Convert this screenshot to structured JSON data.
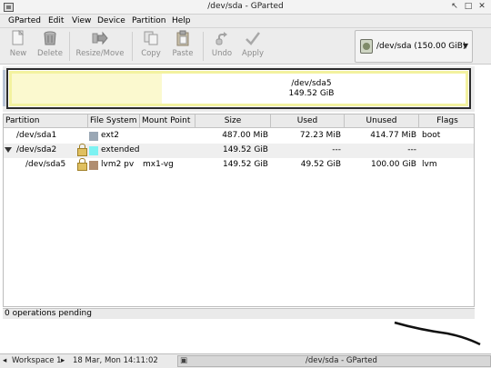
{
  "window": {
    "title": "/dev/sda - GParted",
    "controls": [
      "↖",
      "□",
      "✕"
    ]
  },
  "menu": [
    "GParted",
    "Edit",
    "View",
    "Device",
    "Partition",
    "Help"
  ],
  "toolbar": {
    "buttons": [
      {
        "label": "New",
        "icon": "new-icon"
      },
      {
        "label": "Delete",
        "icon": "delete-icon"
      },
      {
        "label": "Resize/Move",
        "icon": "resize-move-icon"
      },
      {
        "label": "Copy",
        "icon": "copy-icon"
      },
      {
        "label": "Paste",
        "icon": "paste-icon"
      },
      {
        "label": "Undo",
        "icon": "undo-icon"
      },
      {
        "label": "Apply",
        "icon": "apply-icon"
      }
    ],
    "device_selector": "/dev/sda  (150.00 GiB)"
  },
  "visual": {
    "name": "/dev/sda5",
    "size": "149.52 GiB",
    "used_fraction": 0.33
  },
  "table": {
    "columns": [
      "Partition",
      "File System",
      "Mount Point",
      "Size",
      "Used",
      "Unused",
      "Flags"
    ],
    "rows": [
      {
        "partition": "/dev/sda1",
        "filesystem": "ext2",
        "fs_color": "#9aa7b5",
        "mount": "",
        "size": "487.00 MiB",
        "used": "72.23 MiB",
        "unused": "414.77 MiB",
        "flags": "boot",
        "locked": false,
        "expander": false
      },
      {
        "partition": "/dev/sda2",
        "filesystem": "extended",
        "fs_color": "#7df2f2",
        "mount": "",
        "size": "149.52 GiB",
        "used": "---",
        "unused": "---",
        "flags": "",
        "locked": true,
        "expander": true
      },
      {
        "partition": "/dev/sda5",
        "filesystem": "lvm2 pv",
        "fs_color": "#b08d70",
        "mount": "mx1-vg",
        "size": "149.52 GiB",
        "used": "49.52 GiB",
        "unused": "100.00 GiB",
        "flags": "lvm",
        "locked": true,
        "expander": false
      }
    ]
  },
  "status": "0 operations pending",
  "taskbar": {
    "workspace": "Workspace 1",
    "clock": "18 Mar, Mon 14:11:02",
    "app_title": "/dev/sda - GParted"
  },
  "colors": {
    "ext2": "#9aa7b5",
    "extended": "#7df2f2",
    "lvm2": "#b08d70",
    "lock": "#e0c060",
    "visual_border": "#f3f29f",
    "visual_used": "#fbf9cf"
  }
}
